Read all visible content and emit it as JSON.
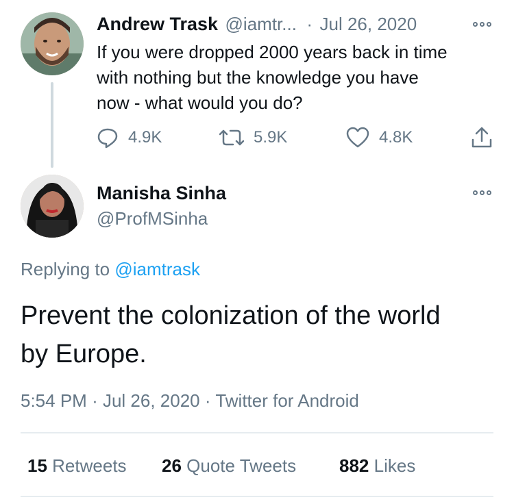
{
  "parent_tweet": {
    "name": "Andrew Trask",
    "handle": "@iamtr...",
    "separator": "·",
    "date": "Jul 26, 2020",
    "text_lines": [
      "If you were dropped 2000 years back in time",
      "with nothing but the knowledge you have",
      "now - what would you do?"
    ],
    "replies": "4.9K",
    "retweets": "5.9K",
    "likes": "4.8K"
  },
  "reply_tweet": {
    "name": "Manisha Sinha",
    "handle": "@ProfMSinha",
    "replying_prefix": "Replying to",
    "replying_handle": "@iamtrask",
    "text_lines": [
      "Prevent the colonization of the world",
      "by Europe."
    ],
    "time": "5:54 PM",
    "sep1": "·",
    "date": "Jul 26, 2020",
    "sep2": "·",
    "client": "Twitter for Android"
  },
  "stats": {
    "retweets_count": "15",
    "retweets_label": "Retweets",
    "quotes_count": "26",
    "quotes_label": "Quote Tweets",
    "likes_count": "882",
    "likes_label": "Likes"
  },
  "colors": {
    "link": "#1da1f2",
    "muted": "#657786",
    "text": "#0f1419"
  },
  "icons": [
    "reply-icon",
    "retweet-icon",
    "like-icon",
    "share-icon",
    "more-icon"
  ]
}
